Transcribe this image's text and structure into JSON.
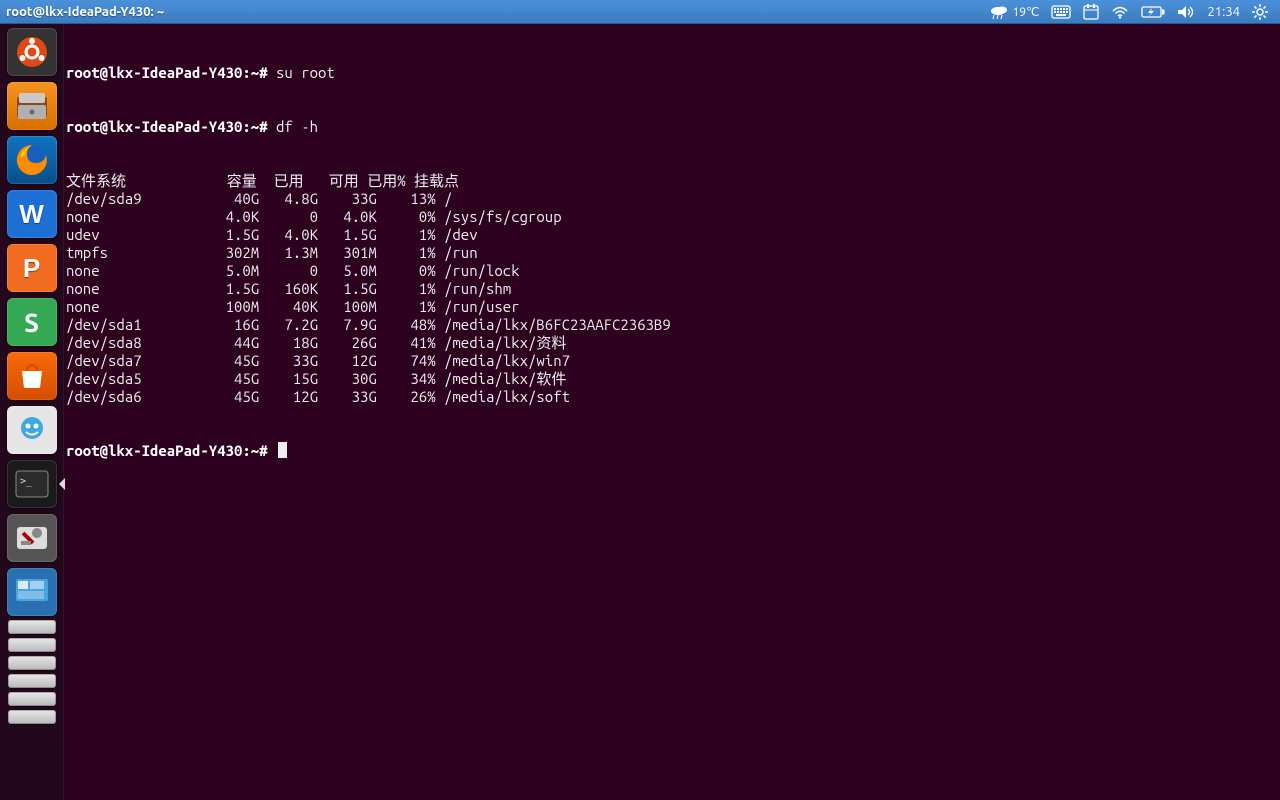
{
  "panel": {
    "title": "root@lkx-IdeaPad-Y430: ~",
    "weather_temp": "19℃",
    "time": "21:34"
  },
  "launcher": {
    "items": [
      {
        "name": "dash",
        "glyph": "ubuntu"
      },
      {
        "name": "files",
        "glyph": "drawer"
      },
      {
        "name": "firefox",
        "glyph": "firefox"
      },
      {
        "name": "wps-writer",
        "glyph": "W"
      },
      {
        "name": "wps-presentation",
        "glyph": "P"
      },
      {
        "name": "wps-spreadsheet",
        "glyph": "S"
      },
      {
        "name": "software-center",
        "glyph": "bag"
      },
      {
        "name": "messenger",
        "glyph": "face"
      },
      {
        "name": "terminal",
        "glyph": "term"
      },
      {
        "name": "settings",
        "glyph": "gear"
      },
      {
        "name": "show-desktop",
        "glyph": "desk"
      }
    ],
    "drives_count": 6
  },
  "terminal": {
    "prompt": "root@lkx-IdeaPad-Y430:~#",
    "cmd1": "su root",
    "cmd2": "df -h",
    "header": {
      "fs": "文件系统",
      "size": "容量",
      "used": "已用",
      "avail": "可用",
      "usep": "已用%",
      "mount": "挂载点"
    },
    "rows": [
      {
        "fs": "/dev/sda9",
        "size": "40G",
        "used": "4.8G",
        "avail": "33G",
        "usep": "13%",
        "mount": "/"
      },
      {
        "fs": "none",
        "size": "4.0K",
        "used": "0",
        "avail": "4.0K",
        "usep": "0%",
        "mount": "/sys/fs/cgroup"
      },
      {
        "fs": "udev",
        "size": "1.5G",
        "used": "4.0K",
        "avail": "1.5G",
        "usep": "1%",
        "mount": "/dev"
      },
      {
        "fs": "tmpfs",
        "size": "302M",
        "used": "1.3M",
        "avail": "301M",
        "usep": "1%",
        "mount": "/run"
      },
      {
        "fs": "none",
        "size": "5.0M",
        "used": "0",
        "avail": "5.0M",
        "usep": "0%",
        "mount": "/run/lock"
      },
      {
        "fs": "none",
        "size": "1.5G",
        "used": "160K",
        "avail": "1.5G",
        "usep": "1%",
        "mount": "/run/shm"
      },
      {
        "fs": "none",
        "size": "100M",
        "used": "40K",
        "avail": "100M",
        "usep": "1%",
        "mount": "/run/user"
      },
      {
        "fs": "/dev/sda1",
        "size": "16G",
        "used": "7.2G",
        "avail": "7.9G",
        "usep": "48%",
        "mount": "/media/lkx/B6FC23AAFC2363B9"
      },
      {
        "fs": "/dev/sda8",
        "size": "44G",
        "used": "18G",
        "avail": "26G",
        "usep": "41%",
        "mount": "/media/lkx/资料"
      },
      {
        "fs": "/dev/sda7",
        "size": "45G",
        "used": "33G",
        "avail": "12G",
        "usep": "74%",
        "mount": "/media/lkx/win7"
      },
      {
        "fs": "/dev/sda5",
        "size": "45G",
        "used": "15G",
        "avail": "30G",
        "usep": "34%",
        "mount": "/media/lkx/软件"
      },
      {
        "fs": "/dev/sda6",
        "size": "45G",
        "used": "12G",
        "avail": "33G",
        "usep": "26%",
        "mount": "/media/lkx/soft"
      }
    ]
  }
}
